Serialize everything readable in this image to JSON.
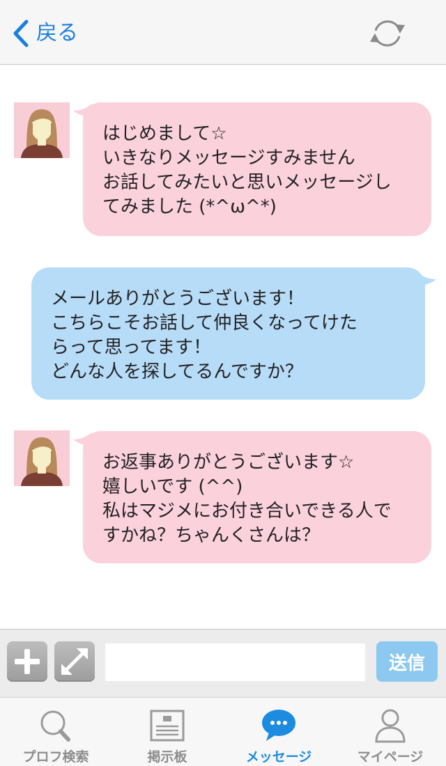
{
  "header": {
    "back_label": "戻る",
    "back_icon": "chevron-left-icon",
    "refresh_icon": "refresh-icon",
    "accent_color": "#1a7ee0"
  },
  "messages": [
    {
      "sender": "partner",
      "lines": [
        "はじめまして☆",
        "いきなりメッセージすみません",
        "お話してみたいと思いメッセージし",
        "てみました (*^ω^*)"
      ]
    },
    {
      "sender": "me",
      "lines": [
        "メールありがとうございます！",
        "こちらこそお話して仲良くなってけた",
        "らって思ってます！",
        "どんな人を探してるんですか？"
      ]
    },
    {
      "sender": "partner",
      "lines": [
        "お返事ありがとうございます☆",
        "嬉しいです (^^)",
        "私はマジメにお付き合いできる人で",
        "すかね？ちゃんくさんは？"
      ]
    }
  ],
  "colors": {
    "partner_bubble": "#fbd1dc",
    "my_bubble": "#b7dcf8",
    "active_tab": "#1c8be0"
  },
  "input_bar": {
    "plus_icon": "plus-icon",
    "expand_icon": "expand-icon",
    "message_value": "",
    "send_label": "送信"
  },
  "tabs": [
    {
      "label": "プロフ検索",
      "icon": "search-icon",
      "active": false
    },
    {
      "label": "掲示板",
      "icon": "bulletin-board-icon",
      "active": false
    },
    {
      "label": "メッセージ",
      "icon": "chat-bubble-icon",
      "active": true
    },
    {
      "label": "マイページ",
      "icon": "user-icon",
      "active": false
    }
  ]
}
